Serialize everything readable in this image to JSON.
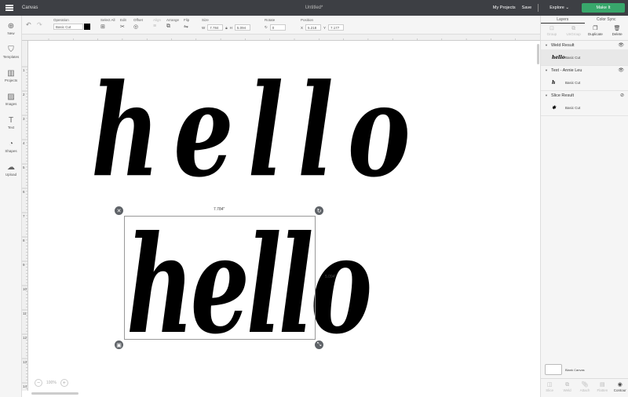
{
  "header": {
    "app_title": "Canvas",
    "doc_title": "Untitled*",
    "my_projects": "My Projects",
    "save": "Save",
    "explore": "Explore",
    "make_it": "Make It",
    "accent_color": "#38a76b"
  },
  "toolbar": {
    "operation_label": "Operation",
    "operation_value": "Basic Cut",
    "select_all": "Select All",
    "edit": "Edit",
    "offset": "Offset",
    "align": "Align",
    "arrange": "Arrange",
    "flip": "Flip",
    "size_label": "Size",
    "width_label": "W",
    "width_value": "7.784",
    "height_label": "H",
    "height_value": "5.094",
    "rotate_label": "Rotate",
    "rotate_value": "0",
    "position_label": "Position",
    "x_label": "X",
    "x_value": "5.218",
    "y_label": "Y",
    "y_value": "7.177"
  },
  "leftbar": {
    "items": [
      {
        "label": "New",
        "icon": "plus-icon"
      },
      {
        "label": "Templates",
        "icon": "shirt-icon"
      },
      {
        "label": "Projects",
        "icon": "projects-icon"
      },
      {
        "label": "Images",
        "icon": "image-icon"
      },
      {
        "label": "Text",
        "icon": "text-icon"
      },
      {
        "label": "Shapes",
        "icon": "shapes-icon"
      },
      {
        "label": "Upload",
        "icon": "upload-icon"
      }
    ]
  },
  "rulers": {
    "h_ticks": [
      "2",
      "3",
      "4",
      "5",
      "6",
      "7",
      "8",
      "9",
      "10",
      "11",
      "12",
      "13",
      "14",
      "15",
      "16",
      "17",
      "18",
      "19",
      "20",
      "21",
      "22"
    ],
    "v_ticks": [
      "1",
      "2",
      "3",
      "4",
      "5",
      "6",
      "7",
      "8",
      "9",
      "10",
      "11",
      "12",
      "13",
      "14"
    ]
  },
  "canvas": {
    "text_top": "hello",
    "text_bottom": "hello",
    "dim_width": "7.784\"",
    "dim_height": "5.094\""
  },
  "zoom": {
    "value": "100%"
  },
  "rightpanel": {
    "tabs": [
      "Layers",
      "Color Sync"
    ],
    "tools": [
      "Group",
      "UnGroup",
      "Duplicate",
      "Delete"
    ],
    "groups": [
      {
        "title": "Weld Result",
        "layer": "Basic Cut",
        "thumb": "hello"
      },
      {
        "title": "Text - Annie Leu",
        "layer": "Basic Cut",
        "thumb": "h"
      },
      {
        "title": "Slice Result",
        "layer": "Basic Cut",
        "thumb": "✱"
      }
    ],
    "blank_canvas": "Blank Canvas",
    "bottom_tools": [
      "Slice",
      "Weld",
      "Attach",
      "Flatten",
      "Contour"
    ]
  }
}
